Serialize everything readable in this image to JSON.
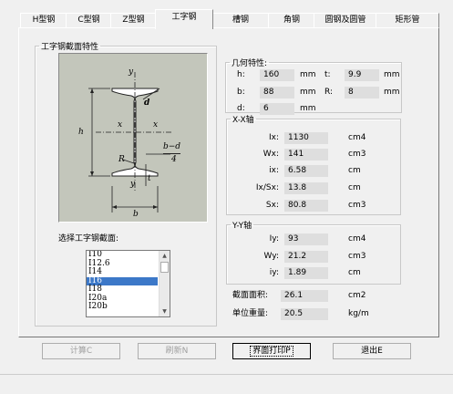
{
  "tabs": [
    {
      "label": "H型钢"
    },
    {
      "label": "C型钢"
    },
    {
      "label": "Z型钢"
    },
    {
      "label": "工字钢"
    },
    {
      "label": "槽钢"
    },
    {
      "label": "角钢"
    },
    {
      "label": "圆钢及圆管"
    },
    {
      "label": "矩形管"
    }
  ],
  "active_tab": "工字钢",
  "section_group": {
    "title": "工字钢截面特性",
    "diagram_labels": {
      "y_top": "y",
      "x_left": "x",
      "x_right": "x",
      "d": "d",
      "h": "h",
      "R": "R",
      "y_bottom": "y",
      "b": "b",
      "t": "t",
      "bd4_num": "b−d",
      "bd4_den": "4"
    },
    "select_label": "选择工字钢截面:",
    "list_items": [
      "I10",
      "I12.6",
      "I14",
      "I16",
      "I18",
      "I20a",
      "I20b"
    ],
    "selected_item": "I16"
  },
  "geometry": {
    "title": "几何特性:",
    "h": {
      "label": "h:",
      "value": "160",
      "unit": "mm"
    },
    "t": {
      "label": "t:",
      "value": "9.9",
      "unit": "mm"
    },
    "b": {
      "label": "b:",
      "value": "88",
      "unit": "mm"
    },
    "R": {
      "label": "R:",
      "value": "8",
      "unit": "mm"
    },
    "d": {
      "label": "d:",
      "value": "6",
      "unit": "mm"
    }
  },
  "xx_axis": {
    "title": "X-X轴",
    "rows": [
      {
        "label": "Ix:",
        "value": "1130",
        "unit": "cm4"
      },
      {
        "label": "Wx:",
        "value": "141",
        "unit": "cm3"
      },
      {
        "label": "ix:",
        "value": "6.58",
        "unit": "cm"
      },
      {
        "label": "Ix/Sx:",
        "value": "13.8",
        "unit": "cm"
      },
      {
        "label": "Sx:",
        "value": "80.8",
        "unit": "cm3"
      }
    ]
  },
  "yy_axis": {
    "title": "Y-Y轴",
    "rows": [
      {
        "label": "Iy:",
        "value": "93",
        "unit": "cm4"
      },
      {
        "label": "Wy:",
        "value": "21.2",
        "unit": "cm3"
      },
      {
        "label": "iy:",
        "value": "1.89",
        "unit": "cm"
      }
    ]
  },
  "area": {
    "label": "截面面积:",
    "value": "26.1",
    "unit": "cm2"
  },
  "weight": {
    "label": "单位重量:",
    "value": "20.5",
    "unit": "kg/m"
  },
  "buttons": {
    "calc": "计算C",
    "refresh": "刷新N",
    "print": "界面打印P",
    "exit": "退出E"
  }
}
